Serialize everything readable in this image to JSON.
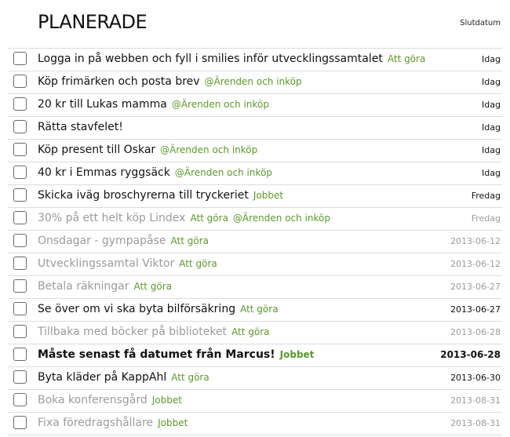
{
  "header": {
    "title": "PLANERADE",
    "sort_label": "Slutdatum"
  },
  "tasks": [
    {
      "text": "Logga in på webben och fyll i smilies inför utvecklingssamtalet",
      "tags": [
        "Att göra"
      ],
      "date": "Idag",
      "state": "normal"
    },
    {
      "text": "Köp frimärken och posta brev",
      "tags": [
        "@Ärenden och inköp"
      ],
      "date": "Idag",
      "state": "normal"
    },
    {
      "text": "20 kr till Lukas mamma",
      "tags": [
        "@Ärenden och inköp"
      ],
      "date": "Idag",
      "state": "normal"
    },
    {
      "text": "Rätta stavfelet!",
      "tags": [],
      "date": "Idag",
      "state": "normal"
    },
    {
      "text": "Köp present till Oskar",
      "tags": [
        "@Ärenden och inköp"
      ],
      "date": "Idag",
      "state": "normal"
    },
    {
      "text": "40 kr i Emmas ryggsäck",
      "tags": [
        "@Ärenden och inköp"
      ],
      "date": "Idag",
      "state": "normal"
    },
    {
      "text": "Skicka iväg broschyrerna till tryckeriet",
      "tags": [
        "Jobbet"
      ],
      "date": "Fredag",
      "state": "normal"
    },
    {
      "text": "30% på ett helt köp Lindex",
      "tags": [
        "Att göra",
        "@Ärenden och inköp"
      ],
      "date": "Fredag",
      "state": "done"
    },
    {
      "text": "Onsdagar - gympapåse",
      "tags": [
        "Att göra"
      ],
      "date": "2013-06-12",
      "state": "done"
    },
    {
      "text": "Utvecklingssamtal Viktor",
      "tags": [
        "Att göra"
      ],
      "date": "2013-06-12",
      "state": "done"
    },
    {
      "text": "Betala räkningar",
      "tags": [
        "Att göra"
      ],
      "date": "2013-06-27",
      "state": "done"
    },
    {
      "text": "Se över om vi ska byta bilförsäkring",
      "tags": [
        "Att göra"
      ],
      "date": "2013-06-27",
      "state": "normal"
    },
    {
      "text": "Tillbaka med böcker på biblioteket",
      "tags": [
        "Att göra"
      ],
      "date": "2013-06-28",
      "state": "done"
    },
    {
      "text": "Måste senast få datumet från Marcus!",
      "tags": [
        "Jobbet"
      ],
      "date": "2013-06-28",
      "state": "bold"
    },
    {
      "text": "Byta kläder på KappAhl",
      "tags": [
        "Att göra"
      ],
      "date": "2013-06-30",
      "state": "normal"
    },
    {
      "text": "Boka konferensgård",
      "tags": [
        "Jobbet"
      ],
      "date": "2013-08-31",
      "state": "done"
    },
    {
      "text": "Fixa föredragshållare",
      "tags": [
        "Jobbet"
      ],
      "date": "2013-08-31",
      "state": "done"
    }
  ]
}
